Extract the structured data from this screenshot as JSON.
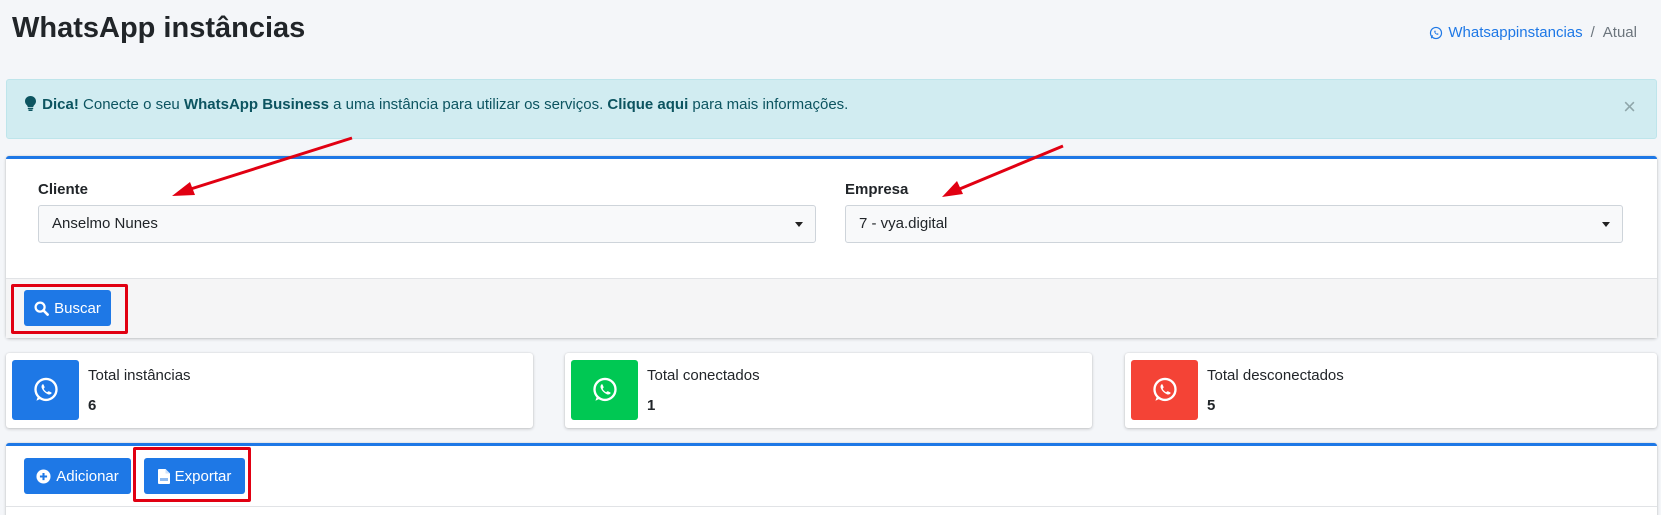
{
  "page": {
    "title": "WhatsApp instâncias"
  },
  "breadcrumb": {
    "link": "Whatsappinstancias",
    "separator": "/",
    "current": "Atual"
  },
  "alert": {
    "dica": "Dica!",
    "text1": " Conecte o seu ",
    "bold1": "WhatsApp Business",
    "text2": " a uma instância para utilizar os serviços. ",
    "bold2": "Clique aqui",
    "text3": " para mais informações.",
    "close": "×"
  },
  "filters": {
    "cliente_label": "Cliente",
    "cliente_value": "Anselmo Nunes",
    "empresa_label": "Empresa",
    "empresa_value": "7 - vya.digital",
    "search_label": "Buscar"
  },
  "stats": [
    {
      "label": "Total instâncias",
      "value": "6",
      "color": "#1e78e6"
    },
    {
      "label": "Total conectados",
      "value": "1",
      "color": "#00c853"
    },
    {
      "label": "Total desconectados",
      "value": "5",
      "color": "#f44336"
    }
  ],
  "actions": {
    "add_label": "Adicionar",
    "export_label": "Exportar"
  },
  "colors": {
    "primary": "#1e78e6",
    "annotation": "#e10012",
    "alert_bg": "#d1ecf1"
  },
  "icons": [
    "whatsapp-icon",
    "lightbulb-icon",
    "search-icon",
    "plus-circle-icon",
    "file-icon",
    "caret-down-icon"
  ]
}
